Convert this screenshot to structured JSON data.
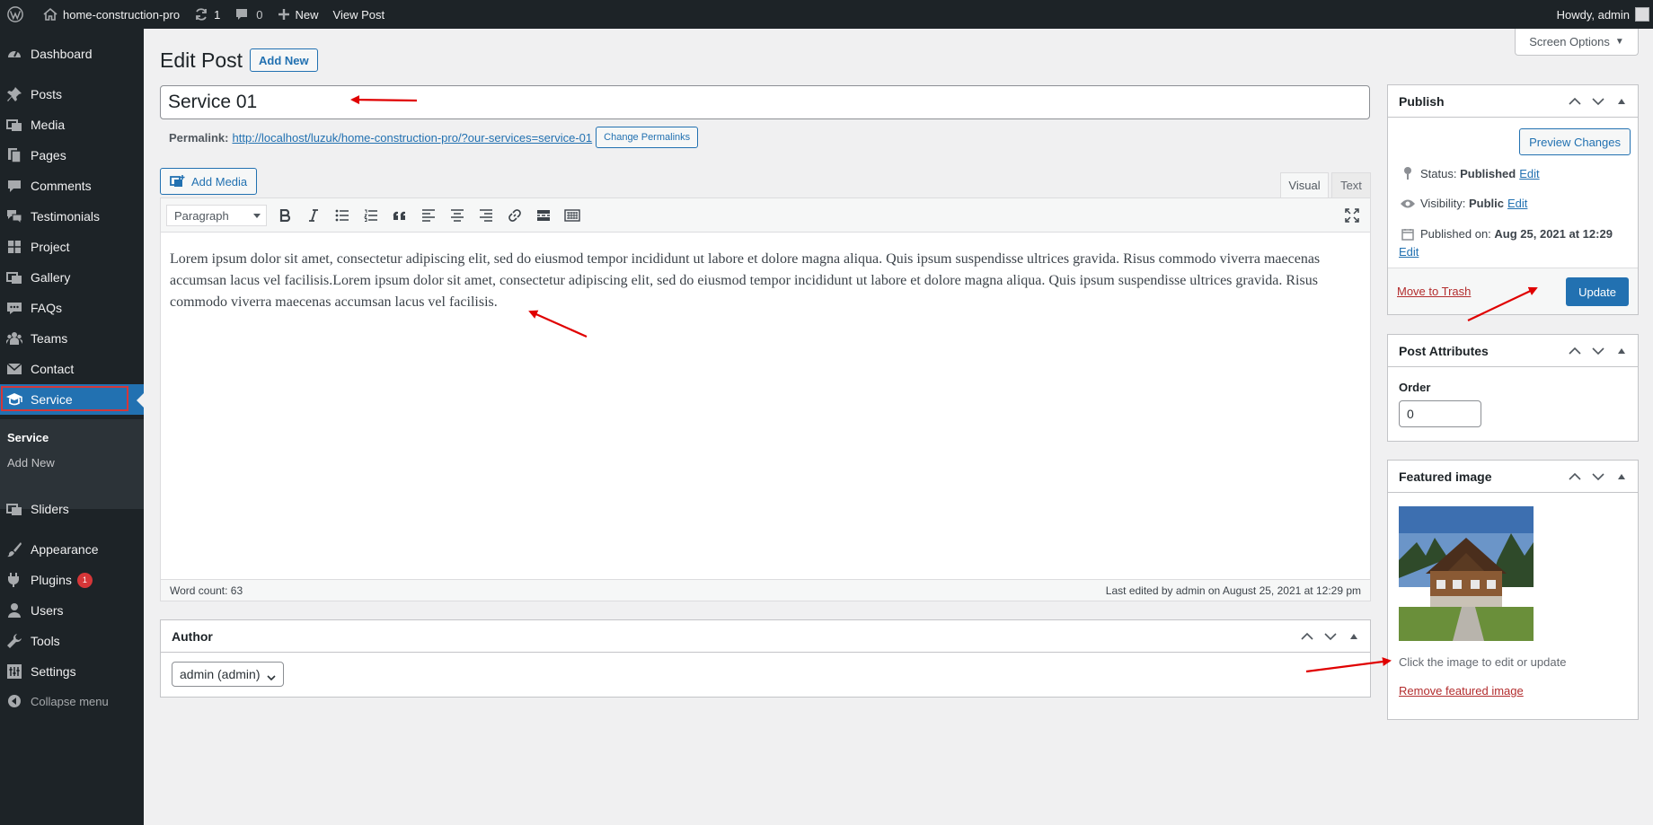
{
  "admin_bar": {
    "site_name": "home-construction-pro",
    "updates_count": "1",
    "comments_count": "0",
    "new_label": "New",
    "view_post_label": "View Post",
    "howdy": "Howdy, admin"
  },
  "sidebar": {
    "items": [
      {
        "label": "Dashboard",
        "icon": "dashboard-icon"
      },
      {
        "label": "Posts",
        "icon": "pin-icon"
      },
      {
        "label": "Media",
        "icon": "media-icon"
      },
      {
        "label": "Pages",
        "icon": "pages-icon"
      },
      {
        "label": "Comments",
        "icon": "comment-icon"
      },
      {
        "label": "Testimonials",
        "icon": "testimonials-icon"
      },
      {
        "label": "Project",
        "icon": "project-icon"
      },
      {
        "label": "Gallery",
        "icon": "gallery-icon"
      },
      {
        "label": "FAQs",
        "icon": "faq-icon"
      },
      {
        "label": "Teams",
        "icon": "teams-icon"
      },
      {
        "label": "Contact",
        "icon": "envelope-icon"
      },
      {
        "label": "Service",
        "icon": "graduation-cap-icon"
      },
      {
        "label": "Sliders",
        "icon": "slides-icon"
      },
      {
        "label": "Appearance",
        "icon": "paintbrush-icon"
      },
      {
        "label": "Plugins",
        "icon": "plugin-icon",
        "badge": "1"
      },
      {
        "label": "Users",
        "icon": "users-icon"
      },
      {
        "label": "Tools",
        "icon": "wrench-icon"
      },
      {
        "label": "Settings",
        "icon": "settings-icon"
      }
    ],
    "submenu": {
      "current": "Service",
      "add_new": "Add New"
    },
    "collapse": "Collapse menu"
  },
  "screen_options": "Screen Options",
  "page": {
    "title": "Edit Post",
    "add_new": "Add New",
    "post_title": "Service 01",
    "permalink_label": "Permalink:",
    "permalink_url": "http://localhost/luzuk/home-construction-pro/?our-services=service-01",
    "change_permalinks": "Change Permalinks"
  },
  "editor": {
    "add_media": "Add Media",
    "tab_visual": "Visual",
    "tab_text": "Text",
    "format": "Paragraph",
    "body_line1": "Lorem ipsum dolor sit amet, consectetur adipiscing elit, sed do eiusmod tempor incididunt ut labore et dolore magna aliqua. Quis ipsum suspendisse ultrices gravida. Risus commodo viverra maecenas",
    "body_line2": "accumsan lacus vel facilisis.Lorem ipsum dolor sit amet, consectetur adipiscing elit, sed do eiusmod tempor incididunt ut labore et dolore magna aliqua. Quis ipsum suspendisse ultrices gravida. Risus",
    "body_line3": "commodo viverra maecenas accumsan lacus vel facilisis.",
    "word_count": "Word count: 63",
    "last_edited": "Last edited by admin on August 25, 2021 at 12:29 pm"
  },
  "author_box": {
    "title": "Author",
    "selected": "admin (admin)"
  },
  "publish": {
    "title": "Publish",
    "preview": "Preview Changes",
    "status_label": "Status:",
    "status_value": "Published",
    "visibility_label": "Visibility:",
    "visibility_value": "Public",
    "published_label": "Published on:",
    "published_value": "Aug 25, 2021 at 12:29",
    "edit": "Edit",
    "trash": "Move to Trash",
    "update": "Update"
  },
  "attributes": {
    "title": "Post Attributes",
    "order_label": "Order",
    "order_value": "0"
  },
  "featured": {
    "title": "Featured image",
    "help": "Click the image to edit or update",
    "remove": "Remove featured image"
  },
  "colors": {
    "accent": "#2271b1",
    "admin_dark": "#1d2327",
    "annotation": "#e00000"
  }
}
